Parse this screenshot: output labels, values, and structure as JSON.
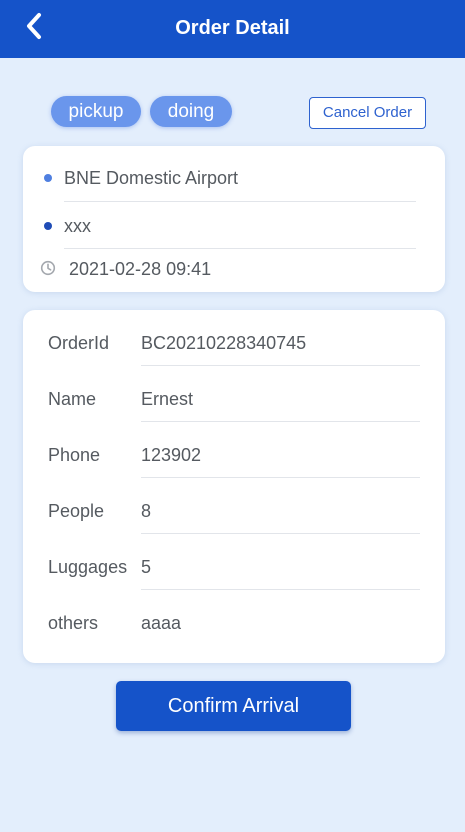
{
  "header": {
    "title": "Order Detail"
  },
  "tags": [
    "pickup",
    "doing"
  ],
  "cancel_label": "Cancel Order",
  "route": {
    "from": "BNE Domestic Airport",
    "to": "xxx",
    "time": "2021-02-28 09:41",
    "from_dot_color": "#4f7fe0",
    "to_dot_color": "#1f4cb6"
  },
  "info": [
    {
      "label": "OrderId",
      "value": "BC20210228340745"
    },
    {
      "label": "Name",
      "value": "Ernest"
    },
    {
      "label": "Phone",
      "value": "123902"
    },
    {
      "label": "People",
      "value": "8"
    },
    {
      "label": "Luggages",
      "value": "5"
    },
    {
      "label": "others",
      "value": "aaaa"
    }
  ],
  "confirm_label": "Confirm Arrival",
  "colors": {
    "primary": "#1553c9",
    "tag": "#6a96ec",
    "background": "#e3eefc"
  },
  "icons": {
    "back": "chevron-left-icon",
    "clock": "clock-icon"
  }
}
